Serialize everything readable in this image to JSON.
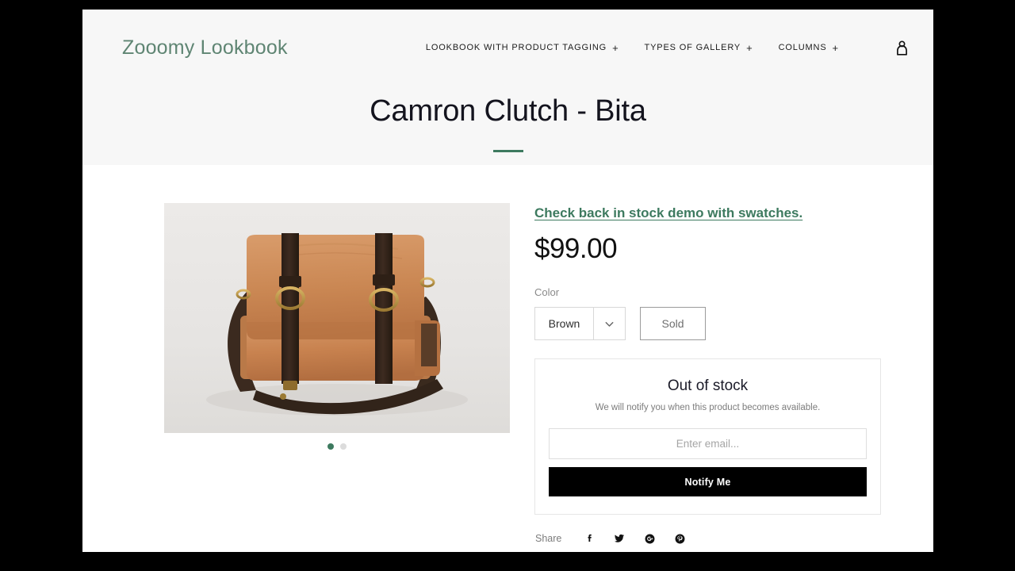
{
  "header": {
    "logo": "Zooomy Lookbook",
    "nav": [
      {
        "label": "LOOKBOOK WITH PRODUCT TAGGING",
        "expander": "+"
      },
      {
        "label": "TYPES OF GALLERY",
        "expander": "+"
      },
      {
        "label": "COLUMNS",
        "expander": "+"
      }
    ],
    "account_icon": "user-icon"
  },
  "page": {
    "title": "Camron Clutch - Bita",
    "accent_color": "#3d7a5f"
  },
  "gallery": {
    "image_alt": "Tan leather messenger bag with dark brown straps",
    "dots": [
      {
        "active": true
      },
      {
        "active": false
      }
    ]
  },
  "product": {
    "stock_link": "Check back in stock demo with swatches.",
    "price": "$99.00",
    "variant_label": "Color",
    "selected_color": "Brown",
    "color_options": [
      "Brown"
    ],
    "availability_badge": "Sold"
  },
  "notify": {
    "title": "Out of stock",
    "subtitle": "We will notify you when this product becomes available.",
    "email_value": "",
    "email_placeholder": "Enter email...",
    "button_label": "Notify Me",
    "button_color": "#000000"
  },
  "share": {
    "label": "Share",
    "icons": [
      "facebook-icon",
      "twitter-icon",
      "google-plus-icon",
      "pinterest-icon"
    ]
  }
}
